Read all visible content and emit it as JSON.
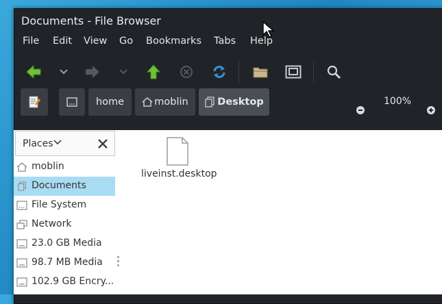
{
  "window": {
    "title": "Documents - File Browser"
  },
  "menu": [
    "File",
    "Edit",
    "View",
    "Go",
    "Bookmarks",
    "Tabs",
    "Help"
  ],
  "toolbar": {
    "icons": [
      "back-arrow-icon",
      "dropdown-chevron-icon",
      "forward-arrow-icon",
      "dropdown-chevron-icon",
      "up-arrow-icon",
      "stop-icon",
      "reload-icon",
      "open-folder-icon",
      "fullscreen-icon",
      "search-icon"
    ]
  },
  "path": {
    "segments": [
      "home",
      "moblin",
      "Desktop"
    ],
    "zoom": "100%"
  },
  "sidebar": {
    "header": "Places",
    "items": [
      {
        "label": "moblin",
        "icon": "home-icon"
      },
      {
        "label": "Documents",
        "icon": "documents-icon",
        "selected": true
      },
      {
        "label": "File System",
        "icon": "drive-icon"
      },
      {
        "label": "Network",
        "icon": "network-icon"
      },
      {
        "label": "23.0 GB Media",
        "icon": "drive-icon"
      },
      {
        "label": "98.7 MB Media",
        "icon": "drive-icon"
      },
      {
        "label": "102.9 GB Encry...",
        "icon": "drive-icon"
      }
    ]
  },
  "files": [
    {
      "name": "liveinst.desktop",
      "icon": "file-icon"
    }
  ],
  "colors": {
    "accent_green": "#6fc13a",
    "selection": "#a9dcf3",
    "reload_blue": "#3a8fd6"
  }
}
